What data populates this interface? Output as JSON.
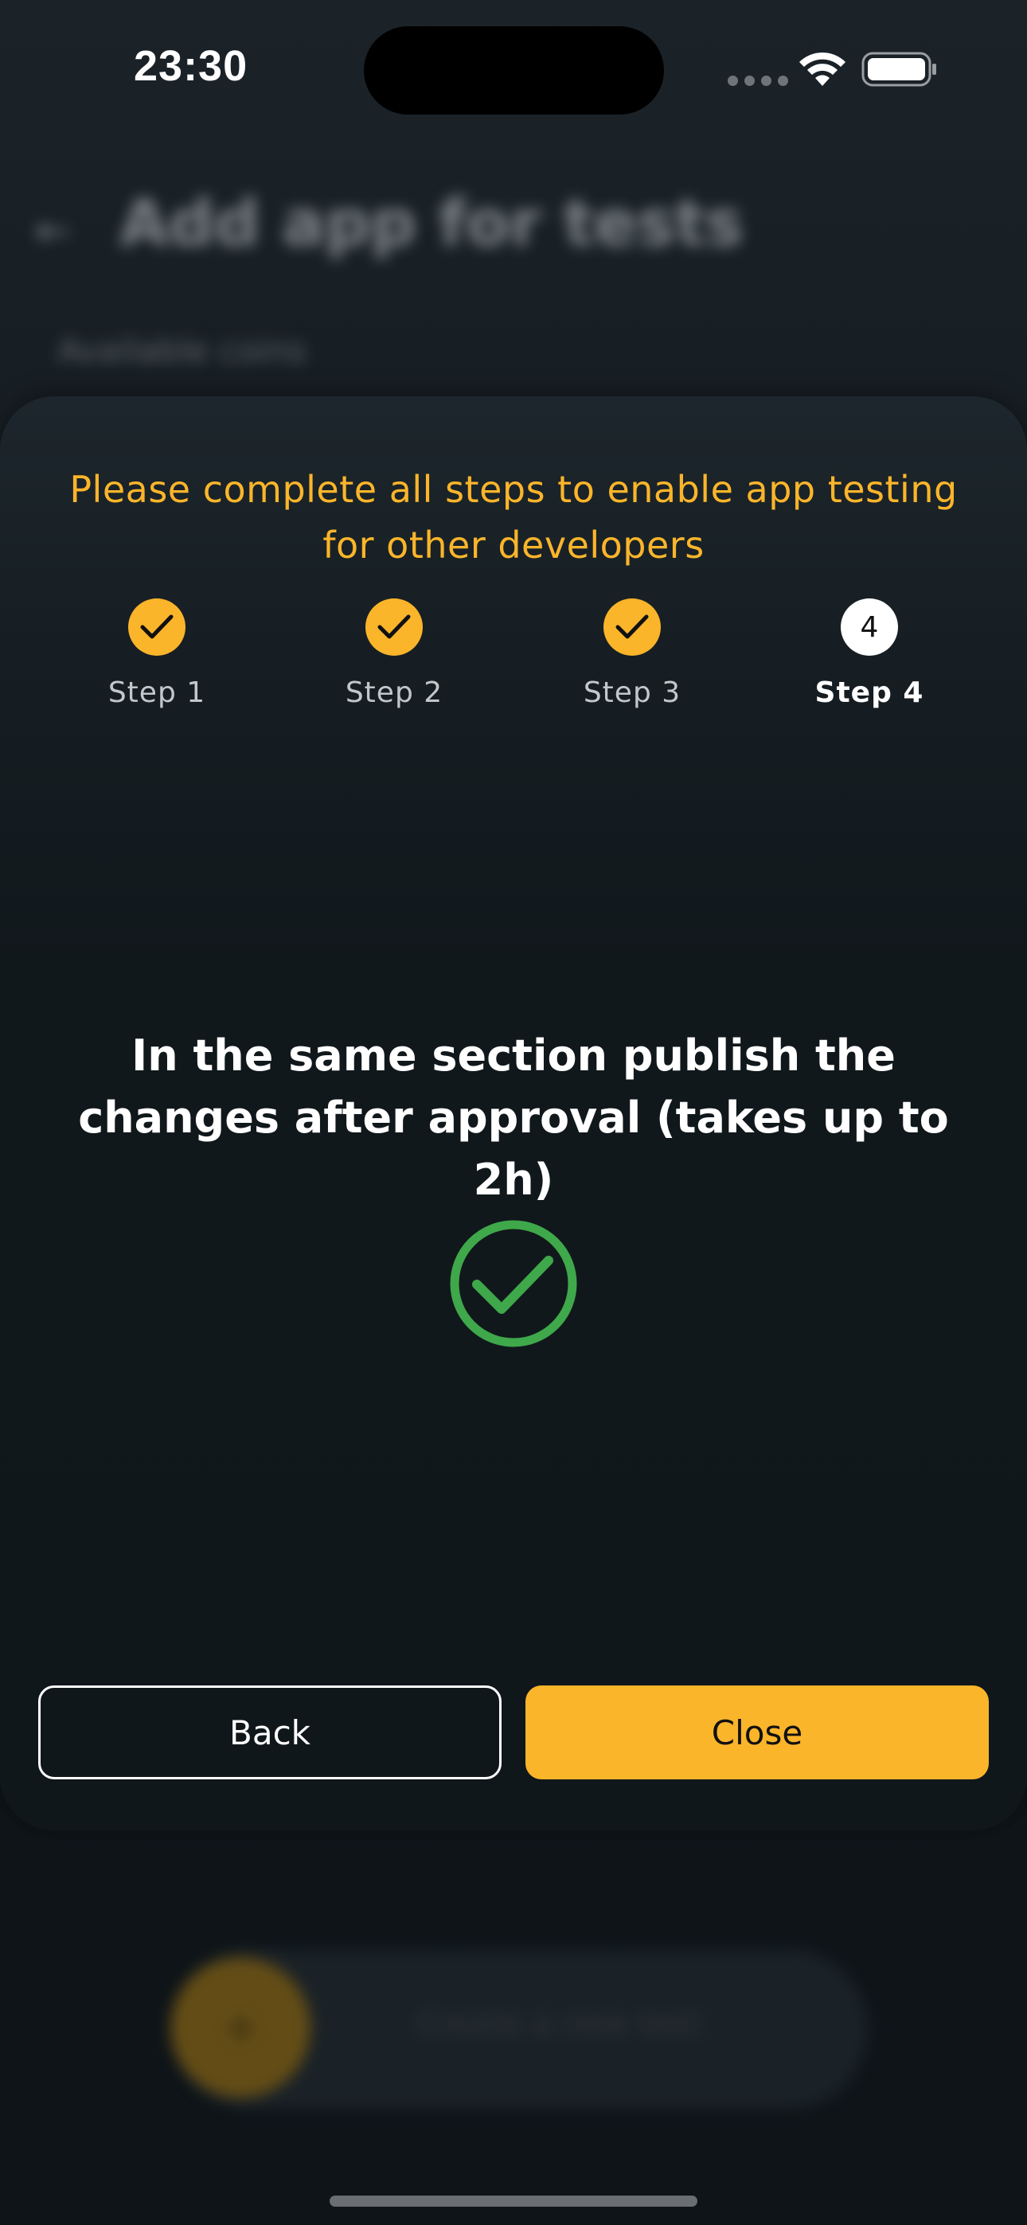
{
  "status_bar": {
    "time": "23:30",
    "wifi_icon": "wifi-icon",
    "battery_icon": "battery-icon",
    "signal_icon": "cellular-signal-icon"
  },
  "background_page": {
    "back_icon": "arrow-left-icon",
    "title": "Add app for tests",
    "subtitle": "Available coins",
    "bottom_button_label": "Create a new test"
  },
  "sheet": {
    "header": "Please complete all steps to enable app testing for other developers",
    "steps": [
      {
        "label": "Step 1",
        "status": "done"
      },
      {
        "label": "Step 2",
        "status": "done"
      },
      {
        "label": "Step 3",
        "status": "done"
      },
      {
        "label": "Step 4",
        "number": "4",
        "status": "current"
      }
    ],
    "instruction": "In the same section publish the changes after approval (takes up to 2h)",
    "success_icon": "check-circle-icon",
    "buttons": {
      "back": "Back",
      "close": "Close"
    }
  },
  "colors": {
    "accent": "#fbb52a",
    "success": "#3fa84a",
    "background": "#0f1519",
    "text": "#ffffff"
  }
}
